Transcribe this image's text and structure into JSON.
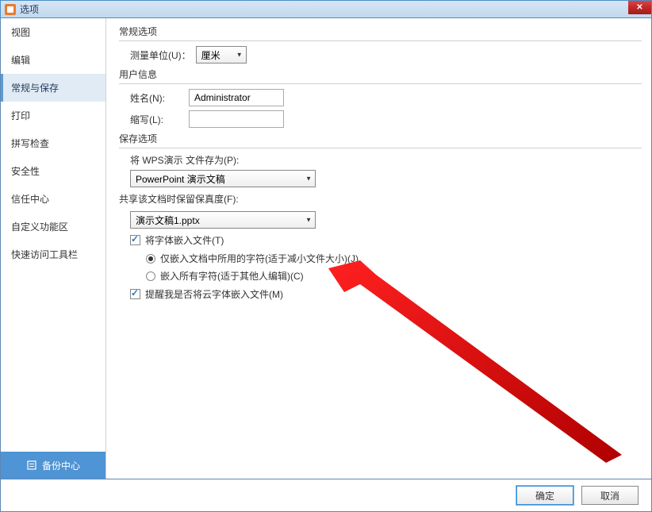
{
  "window": {
    "title": "选项"
  },
  "sidebar": {
    "items": [
      {
        "label": "视图",
        "active": false
      },
      {
        "label": "编辑",
        "active": false
      },
      {
        "label": "常规与保存",
        "active": true
      },
      {
        "label": "打印",
        "active": false
      },
      {
        "label": "拼写检查",
        "active": false
      },
      {
        "label": "安全性",
        "active": false
      },
      {
        "label": "信任中心",
        "active": false
      },
      {
        "label": "自定义功能区",
        "active": false
      },
      {
        "label": "快速访问工具栏",
        "active": false
      }
    ],
    "backup_label": "备份中心"
  },
  "sections": {
    "general": {
      "title": "常规选项",
      "unit_label": "测量单位(U)：",
      "unit_value": "厘米"
    },
    "user": {
      "title": "用户信息",
      "name_label": "姓名(N):",
      "name_value": "Administrator",
      "initials_label": "缩写(L):",
      "initials_value": ""
    },
    "save": {
      "title": "保存选项",
      "save_as_label": "将 WPS演示 文件存为(P):",
      "save_as_value": "PowerPoint 演示文稿",
      "fidelity_label": "共享该文档时保留保真度(F):",
      "fidelity_value": "演示文稿1.pptx",
      "embed_fonts_label": "将字体嵌入文件(T)",
      "embed_fonts_checked": true,
      "radio_used_label": "仅嵌入文档中所用的字符(适于减小文件大小)(J)",
      "radio_used_checked": true,
      "radio_all_label": "嵌入所有字符(适于其他人编辑)(C)",
      "radio_all_checked": false,
      "cloud_fonts_label": "提醒我是否将云字体嵌入文件(M)",
      "cloud_fonts_checked": true
    }
  },
  "footer": {
    "ok_label": "确定",
    "cancel_label": "取消"
  }
}
